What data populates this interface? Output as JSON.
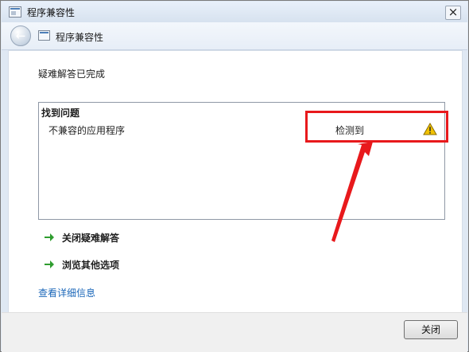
{
  "window": {
    "title": "程序兼容性",
    "close_glyph": "×"
  },
  "nav": {
    "back_icon": "back-arrow-icon",
    "title": "程序兼容性"
  },
  "content": {
    "status_text": "疑难解答已完成",
    "problems": {
      "heading": "找到问题",
      "items": [
        {
          "name": "不兼容的应用程序",
          "status": "检测到",
          "icon": "warning-icon"
        }
      ]
    },
    "actions": [
      {
        "label": "关闭疑难解答",
        "icon": "green-arrow-icon"
      },
      {
        "label": "浏览其他选项",
        "icon": "green-arrow-icon"
      }
    ],
    "details_link": "查看详细信息"
  },
  "footer": {
    "close_button": "关闭"
  },
  "colors": {
    "annotation_red": "#e8191c",
    "link_blue": "#1b67b9",
    "arrow_green": "#2f9d2f",
    "warning_yellow": "#f2c200"
  }
}
